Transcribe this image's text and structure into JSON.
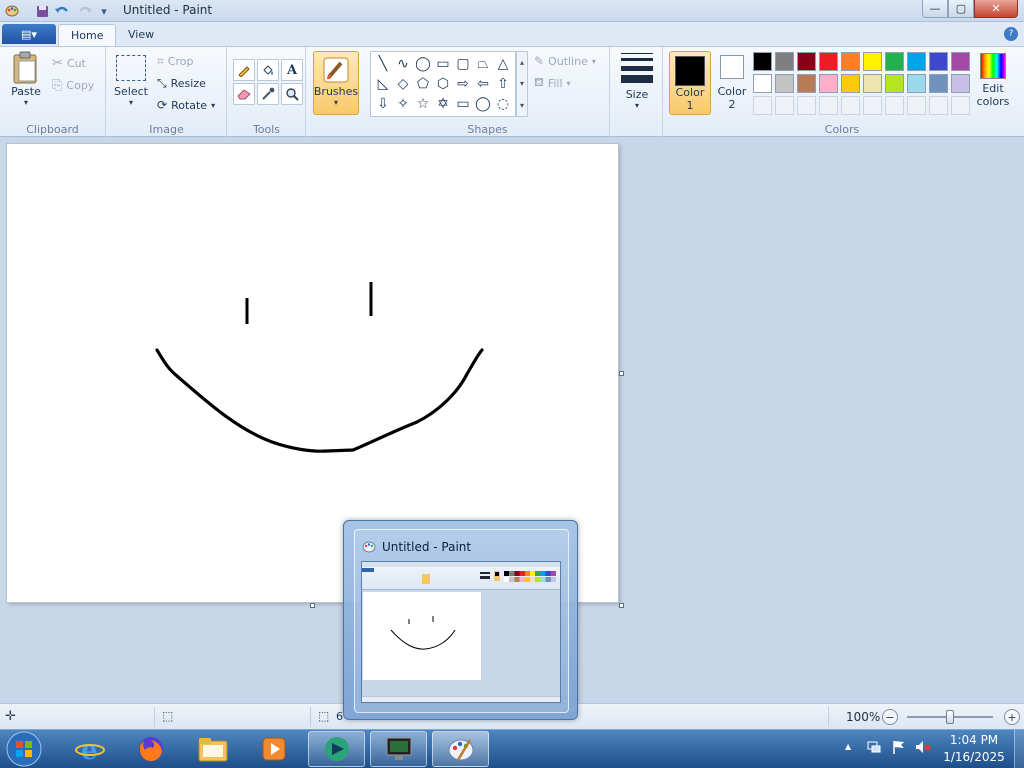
{
  "window": {
    "title": "Untitled - Paint",
    "minimize_glyph": "—",
    "maximize_glyph": "▢",
    "close_glyph": "✕"
  },
  "quick_access": {
    "app_icon": "paint-palette-icon",
    "save_icon": "save-icon",
    "undo_icon": "undo-icon",
    "redo_icon": "redo-icon",
    "customize_glyph": "▾"
  },
  "tabs": {
    "app_menu_glyph": "▤▾",
    "home": "Home",
    "view": "View",
    "help_glyph": "?"
  },
  "ribbon": {
    "clipboard": {
      "label": "Clipboard",
      "paste": "Paste",
      "cut": "Cut",
      "copy": "Copy"
    },
    "image": {
      "label": "Image",
      "select": "Select",
      "crop": "Crop",
      "resize": "Resize",
      "rotate": "Rotate"
    },
    "tools": {
      "label": "Tools",
      "items": [
        "pencil-icon",
        "fill-icon",
        "text-icon",
        "eraser-icon",
        "color-picker-icon",
        "magnifier-icon"
      ],
      "text_glyph": "A"
    },
    "brushes": {
      "label": "Brushes"
    },
    "shapes": {
      "label": "Shapes",
      "outline": "Outline",
      "fill": "Fill",
      "glyphs": [
        "╲",
        "∿",
        "◯",
        "▭",
        "▢",
        "⏢",
        "△",
        "◺",
        "◇",
        "⬠",
        "⬡",
        "⇨",
        "⇦",
        "⇧",
        "⇩",
        "✧",
        "☆",
        "✡",
        "▭",
        "◯",
        "◌"
      ]
    },
    "size": {
      "label": "Size"
    },
    "colors": {
      "label": "Colors",
      "color1": "Color",
      "color1_num": "1",
      "color2": "Color",
      "color2_num": "2",
      "color1_value": "#000000",
      "color2_value": "#ffffff",
      "edit": "Edit",
      "edit2": "colors",
      "row1": [
        "#000000",
        "#7f7f7f",
        "#880015",
        "#ed1c24",
        "#ff7f27",
        "#fff200",
        "#22b14c",
        "#00a2e8",
        "#3f48cc",
        "#a349a4"
      ],
      "row2": [
        "#ffffff",
        "#c3c3c3",
        "#b97a57",
        "#ffaec9",
        "#ffc90e",
        "#efe4b0",
        "#b5e61d",
        "#99d9ea",
        "#7092be",
        "#c8bfe7"
      ]
    }
  },
  "status": {
    "canvas_size_partial": "6",
    "zoom": "100%",
    "zoom_out": "−",
    "zoom_in": "+",
    "zoom_fraction": 0.5
  },
  "thumbnail": {
    "title": "Untitled - Paint"
  },
  "taskbar": {
    "time": "1:04 PM",
    "date": "1/16/2025",
    "tray_up": "▲"
  }
}
